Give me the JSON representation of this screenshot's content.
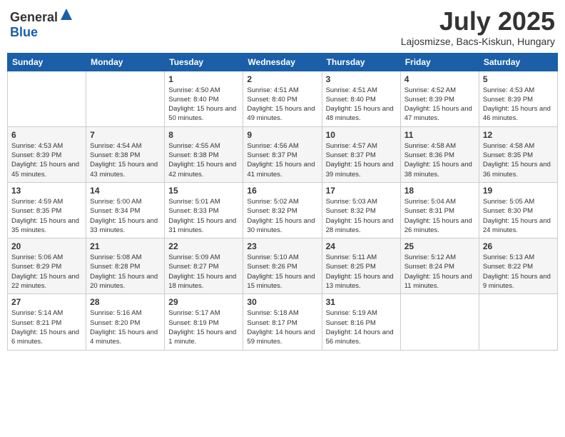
{
  "header": {
    "logo_general": "General",
    "logo_blue": "Blue",
    "month": "July 2025",
    "location": "Lajosmizse, Bacs-Kiskun, Hungary"
  },
  "columns": [
    "Sunday",
    "Monday",
    "Tuesday",
    "Wednesday",
    "Thursday",
    "Friday",
    "Saturday"
  ],
  "weeks": [
    [
      {
        "day": "",
        "info": ""
      },
      {
        "day": "",
        "info": ""
      },
      {
        "day": "1",
        "info": "Sunrise: 4:50 AM\nSunset: 8:40 PM\nDaylight: 15 hours and 50 minutes."
      },
      {
        "day": "2",
        "info": "Sunrise: 4:51 AM\nSunset: 8:40 PM\nDaylight: 15 hours and 49 minutes."
      },
      {
        "day": "3",
        "info": "Sunrise: 4:51 AM\nSunset: 8:40 PM\nDaylight: 15 hours and 48 minutes."
      },
      {
        "day": "4",
        "info": "Sunrise: 4:52 AM\nSunset: 8:39 PM\nDaylight: 15 hours and 47 minutes."
      },
      {
        "day": "5",
        "info": "Sunrise: 4:53 AM\nSunset: 8:39 PM\nDaylight: 15 hours and 46 minutes."
      }
    ],
    [
      {
        "day": "6",
        "info": "Sunrise: 4:53 AM\nSunset: 8:39 PM\nDaylight: 15 hours and 45 minutes."
      },
      {
        "day": "7",
        "info": "Sunrise: 4:54 AM\nSunset: 8:38 PM\nDaylight: 15 hours and 43 minutes."
      },
      {
        "day": "8",
        "info": "Sunrise: 4:55 AM\nSunset: 8:38 PM\nDaylight: 15 hours and 42 minutes."
      },
      {
        "day": "9",
        "info": "Sunrise: 4:56 AM\nSunset: 8:37 PM\nDaylight: 15 hours and 41 minutes."
      },
      {
        "day": "10",
        "info": "Sunrise: 4:57 AM\nSunset: 8:37 PM\nDaylight: 15 hours and 39 minutes."
      },
      {
        "day": "11",
        "info": "Sunrise: 4:58 AM\nSunset: 8:36 PM\nDaylight: 15 hours and 38 minutes."
      },
      {
        "day": "12",
        "info": "Sunrise: 4:58 AM\nSunset: 8:35 PM\nDaylight: 15 hours and 36 minutes."
      }
    ],
    [
      {
        "day": "13",
        "info": "Sunrise: 4:59 AM\nSunset: 8:35 PM\nDaylight: 15 hours and 35 minutes."
      },
      {
        "day": "14",
        "info": "Sunrise: 5:00 AM\nSunset: 8:34 PM\nDaylight: 15 hours and 33 minutes."
      },
      {
        "day": "15",
        "info": "Sunrise: 5:01 AM\nSunset: 8:33 PM\nDaylight: 15 hours and 31 minutes."
      },
      {
        "day": "16",
        "info": "Sunrise: 5:02 AM\nSunset: 8:32 PM\nDaylight: 15 hours and 30 minutes."
      },
      {
        "day": "17",
        "info": "Sunrise: 5:03 AM\nSunset: 8:32 PM\nDaylight: 15 hours and 28 minutes."
      },
      {
        "day": "18",
        "info": "Sunrise: 5:04 AM\nSunset: 8:31 PM\nDaylight: 15 hours and 26 minutes."
      },
      {
        "day": "19",
        "info": "Sunrise: 5:05 AM\nSunset: 8:30 PM\nDaylight: 15 hours and 24 minutes."
      }
    ],
    [
      {
        "day": "20",
        "info": "Sunrise: 5:06 AM\nSunset: 8:29 PM\nDaylight: 15 hours and 22 minutes."
      },
      {
        "day": "21",
        "info": "Sunrise: 5:08 AM\nSunset: 8:28 PM\nDaylight: 15 hours and 20 minutes."
      },
      {
        "day": "22",
        "info": "Sunrise: 5:09 AM\nSunset: 8:27 PM\nDaylight: 15 hours and 18 minutes."
      },
      {
        "day": "23",
        "info": "Sunrise: 5:10 AM\nSunset: 8:26 PM\nDaylight: 15 hours and 15 minutes."
      },
      {
        "day": "24",
        "info": "Sunrise: 5:11 AM\nSunset: 8:25 PM\nDaylight: 15 hours and 13 minutes."
      },
      {
        "day": "25",
        "info": "Sunrise: 5:12 AM\nSunset: 8:24 PM\nDaylight: 15 hours and 11 minutes."
      },
      {
        "day": "26",
        "info": "Sunrise: 5:13 AM\nSunset: 8:22 PM\nDaylight: 15 hours and 9 minutes."
      }
    ],
    [
      {
        "day": "27",
        "info": "Sunrise: 5:14 AM\nSunset: 8:21 PM\nDaylight: 15 hours and 6 minutes."
      },
      {
        "day": "28",
        "info": "Sunrise: 5:16 AM\nSunset: 8:20 PM\nDaylight: 15 hours and 4 minutes."
      },
      {
        "day": "29",
        "info": "Sunrise: 5:17 AM\nSunset: 8:19 PM\nDaylight: 15 hours and 1 minute."
      },
      {
        "day": "30",
        "info": "Sunrise: 5:18 AM\nSunset: 8:17 PM\nDaylight: 14 hours and 59 minutes."
      },
      {
        "day": "31",
        "info": "Sunrise: 5:19 AM\nSunset: 8:16 PM\nDaylight: 14 hours and 56 minutes."
      },
      {
        "day": "",
        "info": ""
      },
      {
        "day": "",
        "info": ""
      }
    ]
  ]
}
